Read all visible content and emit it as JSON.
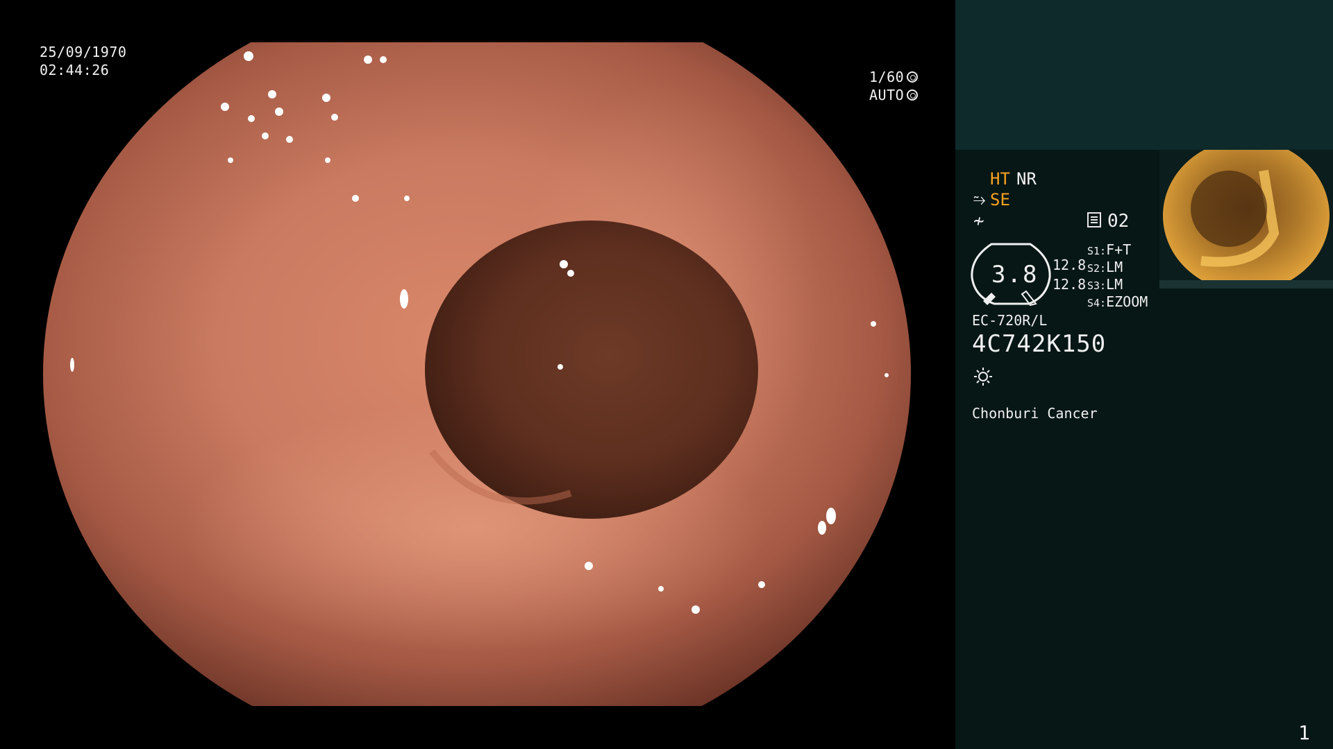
{
  "osd": {
    "date": "25/09/1970",
    "time": "02:44:26",
    "shutter": "1/60",
    "iris": "AUTO"
  },
  "panel": {
    "ht": "HT",
    "nr": "NR",
    "se": "SE",
    "memo": "02",
    "zoom_value": "3.8",
    "value_1": "12.8",
    "value_2": "12.8",
    "s1_label": "S1:",
    "s1_value": "F+T",
    "s2_label": "S2:",
    "s2_value": "LM",
    "s3_label": "S3:",
    "s3_value": "LM",
    "s4_label": "S4:",
    "s4_value": "EZOOM",
    "model": "EC-720R/L",
    "serial": "4C742K150",
    "institution": "Chonburi Cancer",
    "page_number": "1"
  },
  "icons": {
    "shutter_icon": "aperture-icon",
    "iris_icon": "iris-icon",
    "se_icon": "structure-enhance-icon",
    "fn_icon": "function-icon",
    "memo_icon": "memory-icon",
    "light_icon": "light-source-icon"
  },
  "colors": {
    "orange_accent": "#f6a21e",
    "panel_top": "#0e2a2b",
    "panel_bottom": "#071716"
  }
}
